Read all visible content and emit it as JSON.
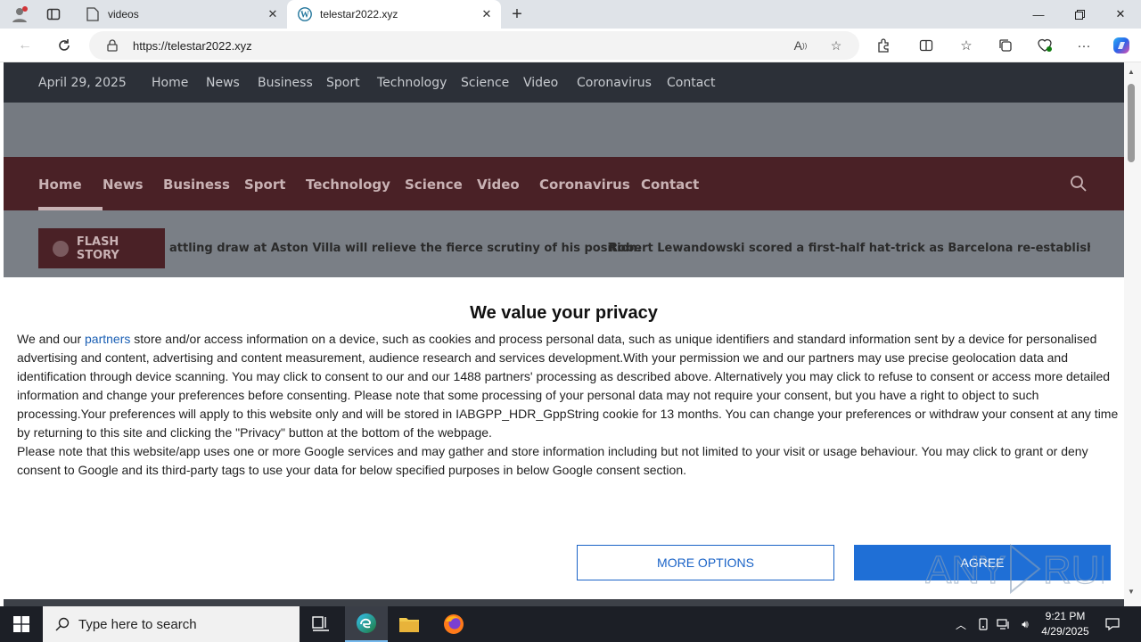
{
  "browser": {
    "tabs": [
      {
        "title": "videos",
        "active": false
      },
      {
        "title": "telestar2022.xyz",
        "active": true
      }
    ],
    "url": "https://telestar2022.xyz"
  },
  "site": {
    "date": "April 29, 2025",
    "top_nav": [
      "Home",
      "News",
      "Business",
      "Sport",
      "Technology",
      "Science",
      "Video",
      "Coronavirus",
      "Contact"
    ],
    "main_nav": [
      "Home",
      "News",
      "Business",
      "Sport",
      "Technology",
      "Science",
      "Video",
      "Coronavirus",
      "Contact"
    ],
    "main_nav_active": "Home",
    "flash_label": "FLASH STORY",
    "ticker": [
      "attling draw at Aston Villa will relieve the fierce scrutiny of his position.",
      "Robert Lewandowski scored a first-half hat-trick as Barcelona re-established their three"
    ]
  },
  "consent": {
    "title": "We value your privacy",
    "intro_prefix": "We and our ",
    "partners_link": "partners",
    "intro_rest": " store and/or access information on a device, such as cookies and process personal data, such as unique identifiers and standard information sent by a device for personalised advertising and content, advertising and content measurement, audience research and services development.With your permission we and our partners may use precise geolocation data and identification through device scanning. You may click to consent to our and our 1488 partners' processing as described above. Alternatively you may click to refuse to consent or access more detailed information and change your preferences before consenting. Please note that some processing of your personal data may not require your consent, but you have a right to object to such processing.Your preferences will apply to this website only and will be stored in IABGPP_HDR_GppString cookie for 13 months. You can change your preferences or withdraw your consent at any time by returning to this site and clicking the \"Privacy\" button at the bottom of the webpage.",
    "google_note": "Please note that this website/app uses one or more Google services and may gather and store information including but not limited to your visit or usage behaviour. You may click to grant or deny consent to Google and its third-party tags to use your data for below specified purposes in below Google consent section.",
    "more_options": "MORE OPTIONS",
    "agree": "AGREE"
  },
  "taskbar": {
    "search_placeholder": "Type here to search",
    "time": "9:21 PM",
    "date": "4/29/2025"
  },
  "watermark": "ANY RUN"
}
